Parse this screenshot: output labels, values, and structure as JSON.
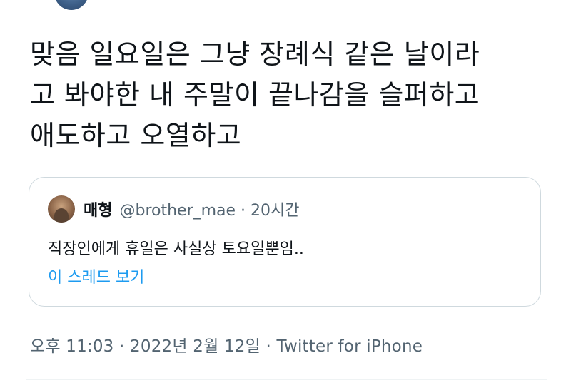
{
  "tweet": {
    "text": "맞음 일요일은 그냥 장례식 같은 날이라\n고 봐야한 내 주말이 끝나감을 슬퍼하고\n애도하고 오열하고"
  },
  "quote": {
    "name": "매형",
    "handle_time": "@brother_mae · 20시간",
    "body": "직장인에게 휴일은 사실상 토요일뿐임..",
    "show_thread": "이 스레드 보기"
  },
  "meta": {
    "timestamp_source": "오후 11:03 · 2022년 2월 12일 · Twitter for iPhone"
  },
  "colors": {
    "link": "#1d9bf0",
    "secondary_text": "#536471",
    "border": "#cfd9de"
  }
}
